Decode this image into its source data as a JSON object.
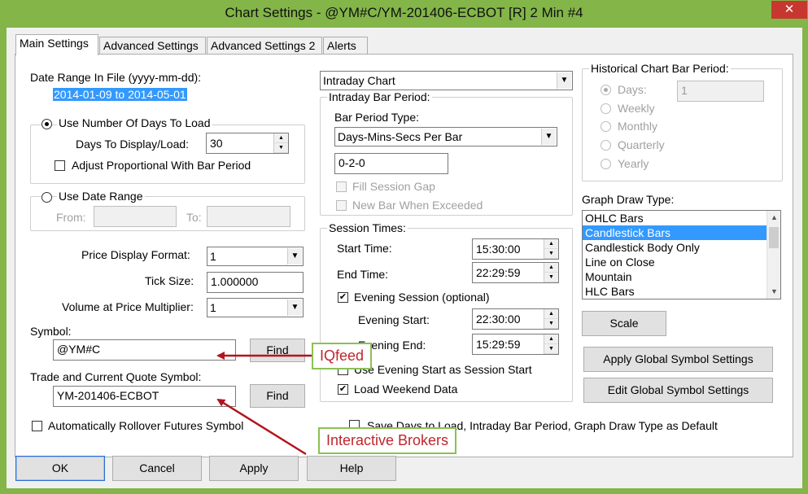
{
  "window": {
    "title": "Chart Settings - @YM#C/YM-201406-ECBOT [R]  2 Min   #4",
    "close_label": "✕"
  },
  "tabs": [
    {
      "label": "Main Settings"
    },
    {
      "label": "Advanced Settings"
    },
    {
      "label": "Advanced Settings 2"
    },
    {
      "label": "Alerts"
    }
  ],
  "left": {
    "date_range_label": "Date Range In File (yyyy-mm-dd):",
    "date_range_value": "2014-01-09 to 2014-05-01",
    "use_days_label": "Use Number Of Days To Load",
    "days_to_display_label": "Days To Display/Load:",
    "days_to_display_value": "30",
    "adjust_proportional_label": "Adjust Proportional With Bar Period",
    "use_date_range_label": "Use Date Range",
    "from_label": "From:",
    "to_label": "To:",
    "price_format_label": "Price Display Format:",
    "price_format_value": "1",
    "tick_size_label": "Tick Size:",
    "tick_size_value": "1.000000",
    "vap_multiplier_label": "Volume at Price Multiplier:",
    "vap_multiplier_value": "1",
    "symbol_label": "Symbol:",
    "symbol_value": "@YM#C",
    "find_label": "Find",
    "trade_symbol_label": "Trade and Current Quote Symbol:",
    "trade_symbol_value": "YM-201406-ECBOT",
    "auto_rollover_label": "Automatically Rollover Futures Symbol"
  },
  "middle": {
    "chart_type_value": "Intraday Chart",
    "intraday_group_label": "Intraday Bar Period:",
    "bar_period_type_label": "Bar Period Type:",
    "bar_period_type_value": "Days-Mins-Secs Per Bar",
    "bar_period_value": "0-2-0",
    "fill_session_gap_label": "Fill Session Gap",
    "new_bar_label": "New Bar When Exceeded",
    "session_group_label": "Session Times:",
    "start_time_label": "Start Time:",
    "start_time_value": "15:30:00",
    "end_time_label": "End Time:",
    "end_time_value": "22:29:59",
    "evening_session_label": "Evening Session (optional)",
    "evening_start_label": "Evening Start:",
    "evening_start_value": "22:30:00",
    "evening_end_label": "Evening End:",
    "evening_end_value": "15:29:59",
    "use_evening_start_label": "Use Evening Start as Session Start",
    "load_weekend_label": "Load Weekend Data",
    "save_default_label": "Save Days to Load, Intraday Bar Period, Graph Draw Type as Default"
  },
  "right": {
    "historical_group_label": "Historical Chart Bar Period:",
    "days_label": "Days:",
    "days_value": "1",
    "weekly_label": "Weekly",
    "monthly_label": "Monthly",
    "quarterly_label": "Quarterly",
    "yearly_label": "Yearly",
    "graph_draw_label": "Graph Draw Type:",
    "graph_draw_items": [
      "OHLC Bars",
      "Candlestick Bars",
      "Candlestick Body Only",
      "Line on Close",
      "Mountain",
      "HLC Bars"
    ],
    "scale_label": "Scale",
    "apply_global_label": "Apply Global Symbol Settings",
    "edit_global_label": "Edit Global Symbol Settings"
  },
  "footer": {
    "ok_label": "OK",
    "cancel_label": "Cancel",
    "apply_label": "Apply",
    "help_label": "Help"
  },
  "annotations": {
    "iqfeed_label": "IQfeed",
    "ib_label": "Interactive Brokers",
    "arrow_color": "#b3141c",
    "border_color": "#8dc053"
  }
}
